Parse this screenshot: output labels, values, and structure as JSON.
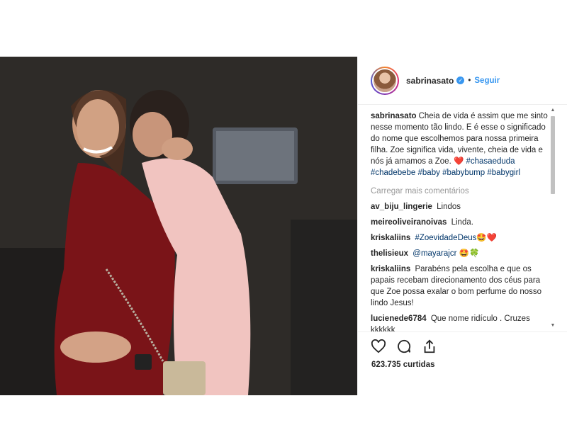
{
  "post": {
    "username": "sabrinasato",
    "follow_label": "Seguir",
    "separator": "•",
    "caption_user": "sabrinasato",
    "caption_text": "Cheia de vida é assim que me sinto nesse momento tão lindo. E é esse o significado do nome que escolhemos para nossa primeira filha. Zoe significa vida, vivente, cheia de vida e nós já amamos a Zoe. ❤️ ",
    "hashtags": [
      "#chasaeduda",
      "#chadebebe",
      "#baby",
      "#babybump",
      "#babygirl"
    ],
    "load_more": "Carregar mais comentários",
    "likes": "623.735 curtidas"
  },
  "comments": [
    {
      "user": "av_biju_lingerie",
      "text": "Lindos"
    },
    {
      "user": "meireoliveiranoivas",
      "text": "Linda."
    },
    {
      "user": "kriskaliins",
      "tag": "#ZoevidadeDeus",
      "text": "🤩❤️"
    },
    {
      "user": "thelisieux",
      "tag": "@mayarajcr",
      "text": "🤩🍀"
    },
    {
      "user": "kriskaliins",
      "text": "Parabéns pela escolha e que os papais recebam direcionamento dos céus para que Zoe possa exalar o bom perfume do nosso lindo Jesus!"
    },
    {
      "user": "lucienede6784",
      "text": "Que nome ridículo . Cruzes kkkkkk"
    }
  ],
  "colors": {
    "link_blue": "#3897f0",
    "hashtag": "#003569",
    "muted": "#999999"
  },
  "icons": [
    "verified-icon",
    "heart-icon",
    "comment-icon",
    "share-icon"
  ]
}
